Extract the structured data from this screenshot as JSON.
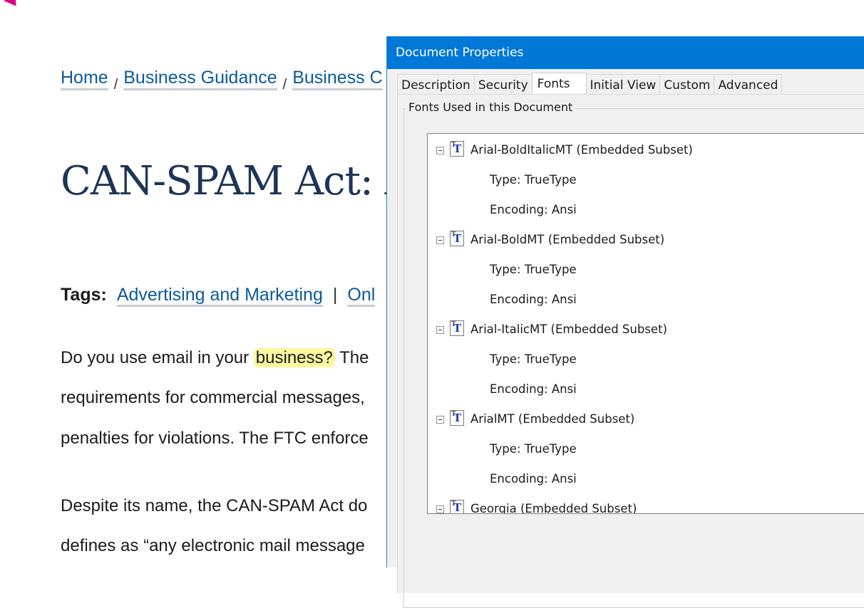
{
  "page": {
    "breadcrumb": [
      {
        "label": "Home"
      },
      {
        "label": "Business Guidance"
      },
      {
        "label": "Business C"
      }
    ],
    "breadcrumb_separator": "/",
    "title": "CAN-SPAM Act: A",
    "tags": {
      "label": "Tags:",
      "items": [
        "Advertising and Marketing",
        "Onl"
      ],
      "separator": "|"
    },
    "paragraph1": {
      "line1_before": "Do you use email in your ",
      "line1_highlight": "business?",
      "line1_after": " The",
      "line2": "requirements for commercial messages,",
      "line3": "penalties for violations. The FTC enforce"
    },
    "paragraph2": {
      "line1": "Despite its name, the CAN-SPAM Act do",
      "line2": "defines as “any electronic mail message"
    },
    "highlight_color": "#fbf8a0",
    "link_color": "#0b5a9c"
  },
  "dialog": {
    "title": "Document Properties",
    "titlebar_color": "#0078d7",
    "tabs": [
      {
        "label": "Description"
      },
      {
        "label": "Security"
      },
      {
        "label": "Fonts",
        "active": true
      },
      {
        "label": "Initial View"
      },
      {
        "label": "Custom"
      },
      {
        "label": "Advanced"
      }
    ],
    "group_label": "Fonts Used in this Document",
    "fonts": [
      {
        "name": "Arial-BoldItalicMT (Embedded Subset)",
        "type": "Type: TrueType",
        "encoding": "Encoding: Ansi",
        "icon": "truetype-font-icon"
      },
      {
        "name": "Arial-BoldMT (Embedded Subset)",
        "type": "Type: TrueType",
        "encoding": "Encoding: Ansi",
        "icon": "truetype-font-icon"
      },
      {
        "name": "Arial-ItalicMT (Embedded Subset)",
        "type": "Type: TrueType",
        "encoding": "Encoding: Ansi",
        "icon": "truetype-font-icon"
      },
      {
        "name": "ArialMT (Embedded Subset)",
        "type": "Type: TrueType",
        "encoding": "Encoding: Ansi",
        "icon": "truetype-font-icon"
      },
      {
        "name": "Georgia (Embedded Subset)",
        "type": "",
        "encoding": "",
        "icon": "truetype-font-icon"
      }
    ]
  }
}
